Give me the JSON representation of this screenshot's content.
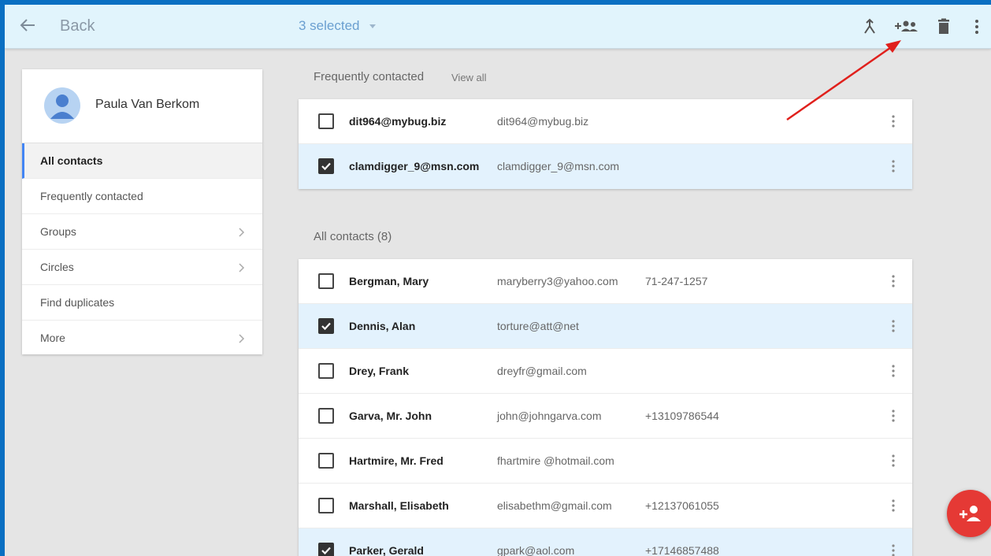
{
  "topbar": {
    "back_label": "Back",
    "selection_label": "3 selected",
    "icons": [
      "merge-icon",
      "add-to-group-icon",
      "delete-icon",
      "more-vert-icon"
    ]
  },
  "sidebar": {
    "profile_name": "Paula Van Berkom",
    "items": [
      {
        "label": "All contacts",
        "active": true,
        "chevron": false
      },
      {
        "label": "Frequently contacted",
        "active": false,
        "chevron": false
      },
      {
        "label": "Groups",
        "active": false,
        "chevron": true
      },
      {
        "label": "Circles",
        "active": false,
        "chevron": true
      },
      {
        "label": "Find duplicates",
        "active": false,
        "chevron": false
      },
      {
        "label": "More",
        "active": false,
        "chevron": true
      }
    ]
  },
  "frequent": {
    "heading": "Frequently contacted",
    "view_all": "View all",
    "rows": [
      {
        "name": "dit964@mybug.biz",
        "email": "dit964@mybug.biz",
        "phone": "",
        "checked": false
      },
      {
        "name": "clamdigger_9@msn.com",
        "email": "clamdigger_9@msn.com",
        "phone": "",
        "checked": true
      }
    ]
  },
  "all": {
    "heading": "All contacts (8)",
    "rows": [
      {
        "name": "Bergman, Mary",
        "email": "maryberry3@yahoo.com",
        "phone": "71-247-1257",
        "checked": false
      },
      {
        "name": "Dennis, Alan",
        "email": "torture@att@net",
        "phone": "",
        "checked": true
      },
      {
        "name": "Drey, Frank",
        "email": "dreyfr@gmail.com",
        "phone": "",
        "checked": false
      },
      {
        "name": "Garva, Mr. John",
        "email": "john@johngarva.com",
        "phone": "+13109786544",
        "checked": false
      },
      {
        "name": "Hartmire, Mr. Fred",
        "email": "fhartmire @hotmail.com",
        "phone": "",
        "checked": false
      },
      {
        "name": "Marshall, Elisabeth",
        "email": "elisabethm@gmail.com",
        "phone": "+12137061055",
        "checked": false
      },
      {
        "name": "Parker, Gerald",
        "email": "gpark@aol.com",
        "phone": "+17146857488",
        "checked": true
      }
    ]
  },
  "colors": {
    "topbar_bg": "#e1f4fc",
    "selected_row_bg": "#e3f2fd",
    "fab": "#e53935",
    "annotation_arrow": "#e0201c",
    "outer_border": "#0a6fc2"
  }
}
